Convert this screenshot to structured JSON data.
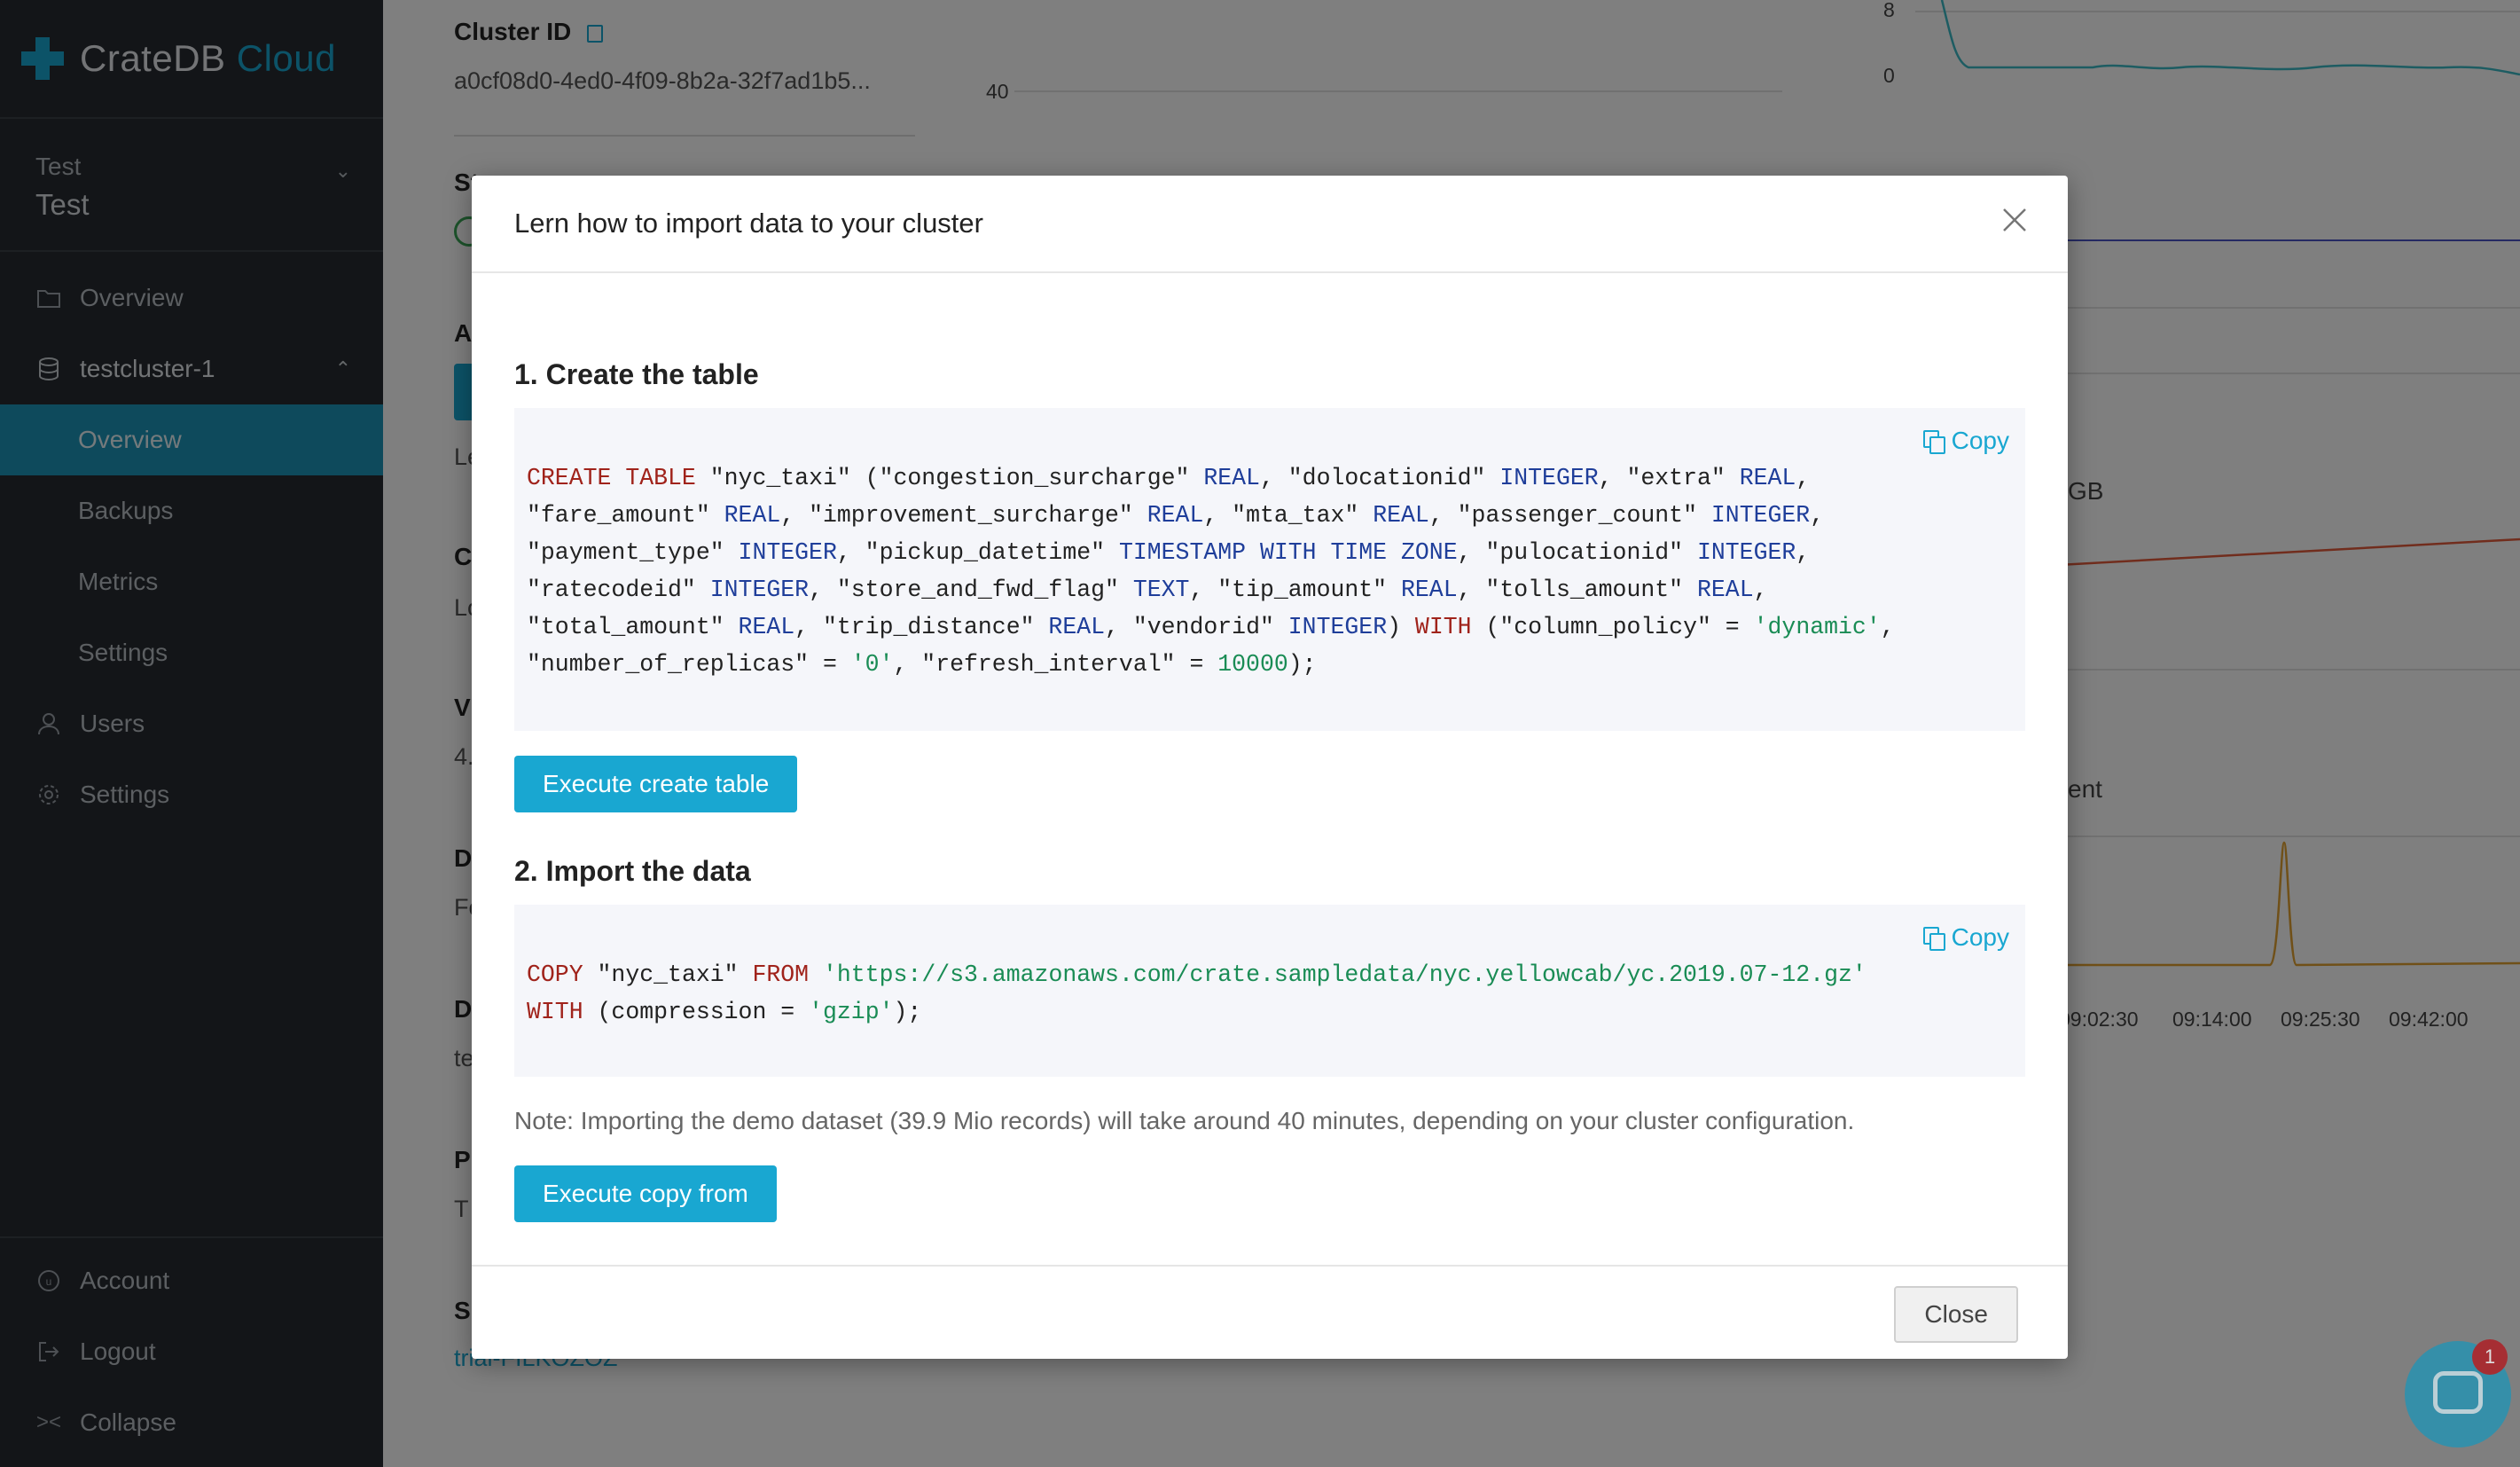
{
  "sidebar": {
    "brand_name": "CrateDB",
    "brand_suffix": "Cloud",
    "org_small": "Test",
    "org_big": "Test",
    "items": {
      "overview": "Overview",
      "cluster": "testcluster-1",
      "cluster_overview": "Overview",
      "backups": "Backups",
      "metrics": "Metrics",
      "cluster_settings": "Settings",
      "users": "Users",
      "settings": "Settings"
    },
    "bottom": {
      "account": "Account",
      "logout": "Logout",
      "collapse": "Collapse"
    }
  },
  "background": {
    "cluster_id_label": "Cluster ID",
    "cluster_id_value": "a0cf08d0-4ed0-4f09-8b2a-32f7ad1b5...",
    "chart_tick_40": "40",
    "chart_tick_8": "8",
    "chart_tick_0": "0",
    "unit_gb": "GB",
    "partial_ent": "ent",
    "time_labels": [
      "09:02:30",
      "09:14:00",
      "09:25:30",
      "09:42:00"
    ],
    "plan_link": "trial-FILKOZOZ",
    "side_initials": [
      "St",
      "A",
      "Le",
      "C",
      "Lo",
      "V",
      "4.",
      "D",
      "Fo",
      "D",
      "te",
      "P",
      "T",
      "S"
    ]
  },
  "modal": {
    "title": "Lern how to import data to your cluster",
    "step1_title": "1. Create the table",
    "step2_title": "2. Import the data",
    "copy_label": "Copy",
    "execute_create_label": "Execute create table",
    "execute_copy_label": "Execute copy from",
    "note": "Note: Importing the demo dataset (39.9 Mio records) will take around 40 minutes, depending on your cluster configuration.",
    "close_label": "Close",
    "create_sql": "CREATE TABLE \"nyc_taxi\" (\"congestion_surcharge\" REAL, \"dolocationid\" INTEGER, \"extra\" REAL, \"fare_amount\" REAL, \"improvement_surcharge\" REAL, \"mta_tax\" REAL, \"passenger_count\" INTEGER, \"payment_type\" INTEGER, \"pickup_datetime\" TIMESTAMP WITH TIME ZONE, \"pulocationid\" INTEGER, \"ratecodeid\" INTEGER, \"store_and_fwd_flag\" TEXT, \"tip_amount\" REAL, \"tolls_amount\" REAL, \"total_amount\" REAL, \"trip_distance\" REAL, \"vendorid\" INTEGER) WITH (\"column_policy\" = 'dynamic', \"number_of_replicas\" = '0', \"refresh_interval\" = 10000);",
    "copy_sql": "COPY \"nyc_taxi\" FROM 'https://s3.amazonaws.com/crate.sampledata/nyc.yellowcab/yc.2019.07-12.gz' WITH (compression = 'gzip');"
  },
  "chat": {
    "badge_count": "1"
  },
  "colors": {
    "accent": "#19a7d1",
    "sidebar_bg": "#262b30",
    "sql_keyword": "#a0231b",
    "sql_type": "#1f3e9a",
    "sql_string": "#1a8c55"
  }
}
